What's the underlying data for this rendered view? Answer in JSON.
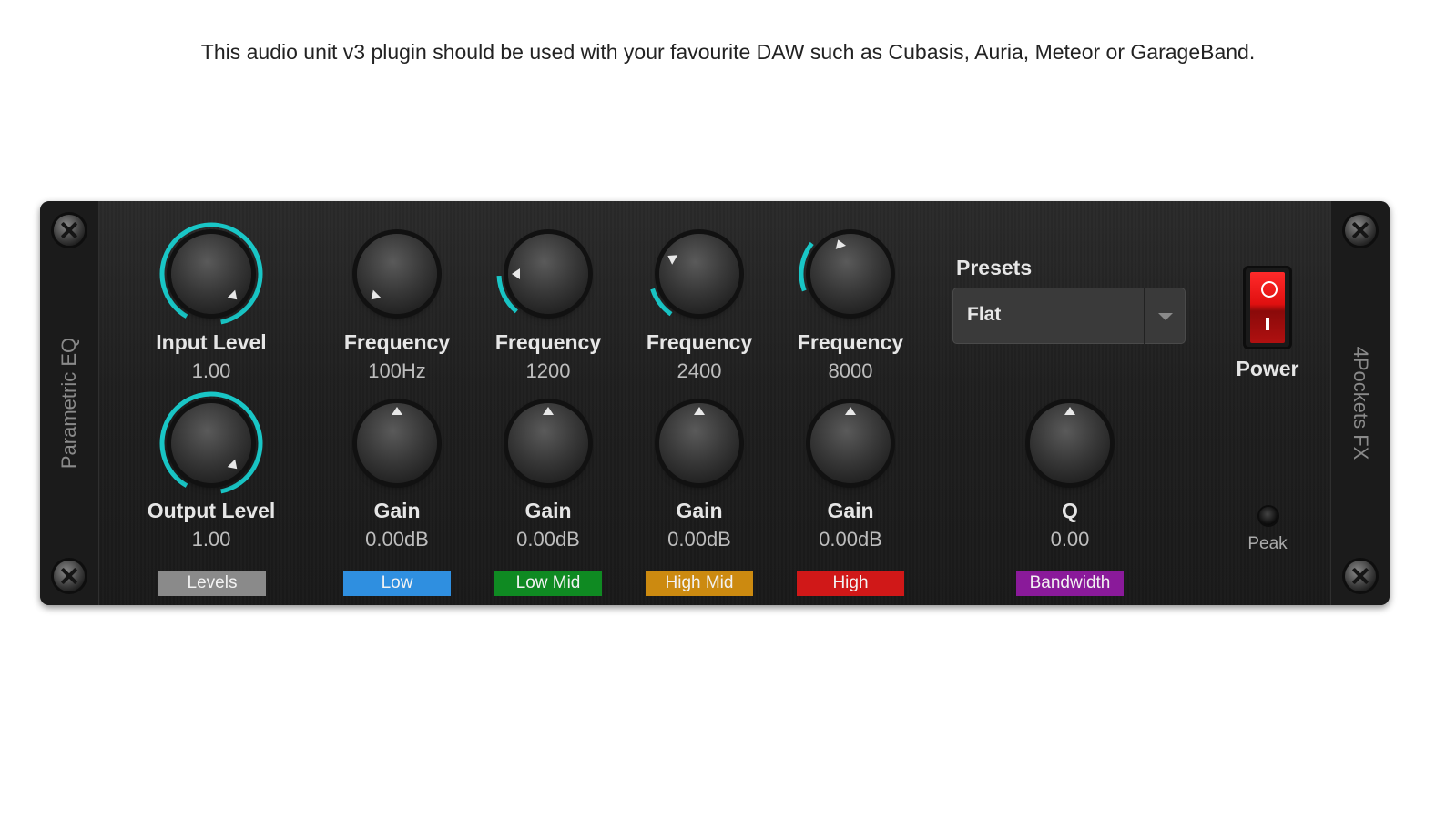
{
  "caption": "This audio unit v3 plugin should be used with your favourite DAW such as Cubasis, Auria, Meteor or GarageBand.",
  "plugin": {
    "name": "Parametric EQ",
    "brand": "4Pockets FX"
  },
  "levels": {
    "input": {
      "label": "Input Level",
      "value": "1.00"
    },
    "output": {
      "label": "Output Level",
      "value": "1.00"
    },
    "tag": "Levels",
    "tag_color": "#8a8a8a"
  },
  "bands": [
    {
      "name": "Low",
      "color": "#2f8fe0",
      "frequency_label": "Frequency",
      "frequency_value": "100Hz",
      "gain_label": "Gain",
      "gain_value": "0.00dB"
    },
    {
      "name": "Low Mid",
      "color": "#0f8a22",
      "frequency_label": "Frequency",
      "frequency_value": "1200",
      "gain_label": "Gain",
      "gain_value": "0.00dB"
    },
    {
      "name": "High Mid",
      "color": "#cc8a10",
      "frequency_label": "Frequency",
      "frequency_value": "2400",
      "gain_label": "Gain",
      "gain_value": "0.00dB"
    },
    {
      "name": "High",
      "color": "#d01818",
      "frequency_label": "Frequency",
      "frequency_value": "8000",
      "gain_label": "Gain",
      "gain_value": "0.00dB"
    }
  ],
  "bandwidth": {
    "label": "Q",
    "value": "0.00",
    "tag": "Bandwidth",
    "tag_color": "#8a1a9a"
  },
  "presets": {
    "label": "Presets",
    "selected": "Flat"
  },
  "power": {
    "label": "Power",
    "state": "on"
  },
  "peak": {
    "label": "Peak"
  },
  "accent_color": "#19c6c6"
}
